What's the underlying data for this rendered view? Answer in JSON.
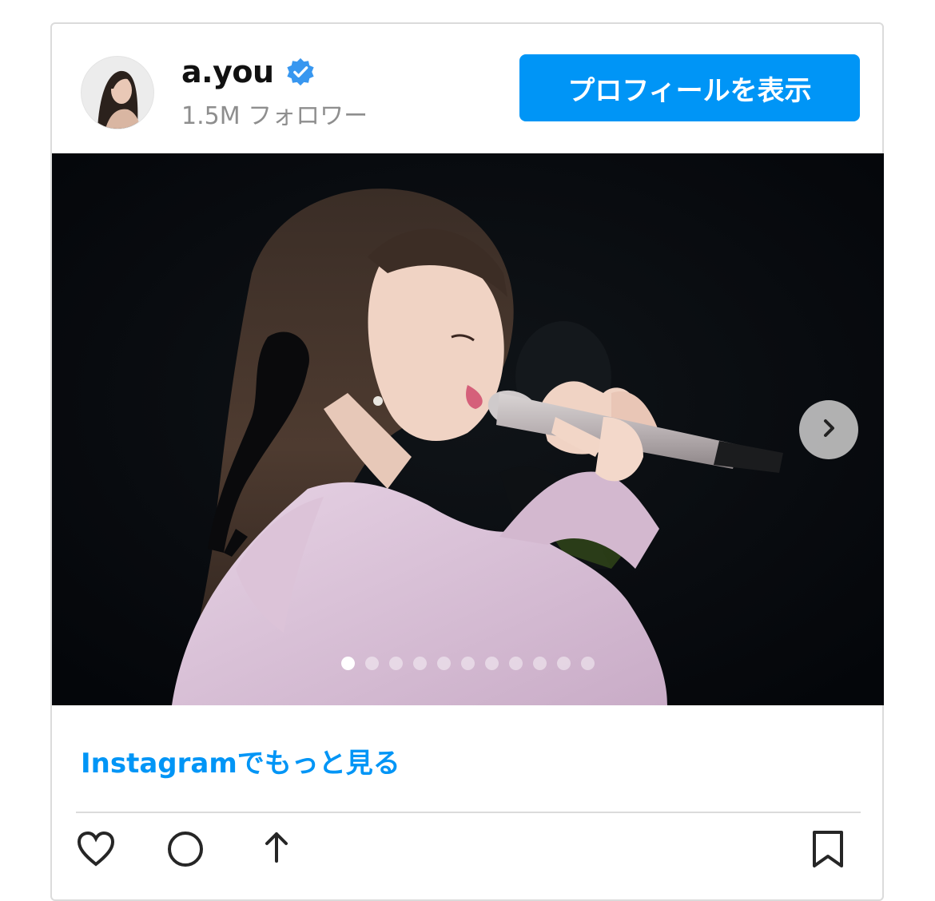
{
  "header": {
    "username": "a.you",
    "followers": "1.5M フォロワー",
    "profile_button_label": "プロフィールを表示",
    "verified_icon": "verified-badge-icon",
    "accent_color": "#0095f6"
  },
  "media": {
    "carousel": {
      "total_slides": 11,
      "active_index": 0,
      "next_icon": "chevron-right-icon"
    }
  },
  "footer": {
    "more_link": "Instagramでもっと見る",
    "actions": [
      "heart-icon",
      "comment-icon",
      "share-icon",
      "bookmark-icon"
    ]
  }
}
